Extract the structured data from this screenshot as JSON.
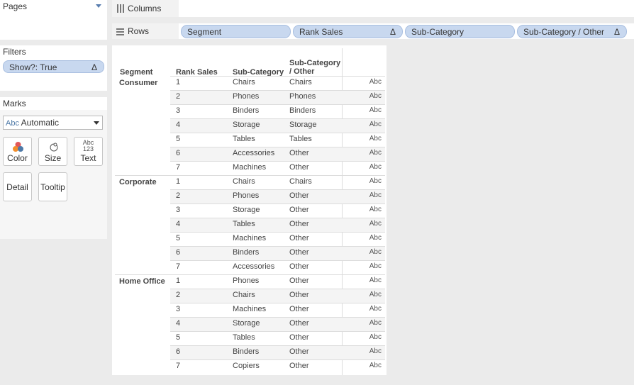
{
  "pages": {
    "title": "Pages"
  },
  "filters": {
    "title": "Filters",
    "pill": "Show?: True",
    "pill_delta": "Δ"
  },
  "marks": {
    "title": "Marks",
    "type_icon": "Abc",
    "type": "Automatic",
    "buttons": {
      "color": "Color",
      "size": "Size",
      "text": "Text",
      "detail": "Detail",
      "tooltip": "Tooltip"
    },
    "text_icon_top": "Abc",
    "text_icon_bottom": "123"
  },
  "columns_shelf": {
    "label": "Columns"
  },
  "rows_shelf": {
    "label": "Rows",
    "pills": [
      {
        "label": "Segment",
        "delta": ""
      },
      {
        "label": "Rank Sales",
        "delta": "Δ"
      },
      {
        "label": "Sub-Category",
        "delta": ""
      },
      {
        "label": "Sub-Category / Other",
        "delta": "Δ"
      }
    ]
  },
  "table": {
    "headers": {
      "segment": "Segment",
      "rank": "Rank Sales",
      "subcat": "Sub-Category",
      "other_line1": "Sub-Category",
      "other_line2": "/ Other"
    },
    "cell_marker": "Abc",
    "groups": [
      {
        "segment": "Consumer",
        "rows": [
          {
            "rank": "1",
            "sub": "Chairs",
            "other": "Chairs"
          },
          {
            "rank": "2",
            "sub": "Phones",
            "other": "Phones"
          },
          {
            "rank": "3",
            "sub": "Binders",
            "other": "Binders"
          },
          {
            "rank": "4",
            "sub": "Storage",
            "other": "Storage"
          },
          {
            "rank": "5",
            "sub": "Tables",
            "other": "Tables"
          },
          {
            "rank": "6",
            "sub": "Accessories",
            "other": "Other"
          },
          {
            "rank": "7",
            "sub": "Machines",
            "other": "Other"
          }
        ]
      },
      {
        "segment": "Corporate",
        "rows": [
          {
            "rank": "1",
            "sub": "Chairs",
            "other": "Chairs"
          },
          {
            "rank": "2",
            "sub": "Phones",
            "other": "Other"
          },
          {
            "rank": "3",
            "sub": "Storage",
            "other": "Other"
          },
          {
            "rank": "4",
            "sub": "Tables",
            "other": "Other"
          },
          {
            "rank": "5",
            "sub": "Machines",
            "other": "Other"
          },
          {
            "rank": "6",
            "sub": "Binders",
            "other": "Other"
          },
          {
            "rank": "7",
            "sub": "Accessories",
            "other": "Other"
          }
        ]
      },
      {
        "segment": "Home Office",
        "rows": [
          {
            "rank": "1",
            "sub": "Phones",
            "other": "Other"
          },
          {
            "rank": "2",
            "sub": "Chairs",
            "other": "Other"
          },
          {
            "rank": "3",
            "sub": "Machines",
            "other": "Other"
          },
          {
            "rank": "4",
            "sub": "Storage",
            "other": "Other"
          },
          {
            "rank": "5",
            "sub": "Tables",
            "other": "Other"
          },
          {
            "rank": "6",
            "sub": "Binders",
            "other": "Other"
          },
          {
            "rank": "7",
            "sub": "Copiers",
            "other": "Other"
          }
        ]
      }
    ]
  },
  "colors": {
    "pill_bg": "#c8d8ef",
    "accent": "#4e79a7"
  }
}
